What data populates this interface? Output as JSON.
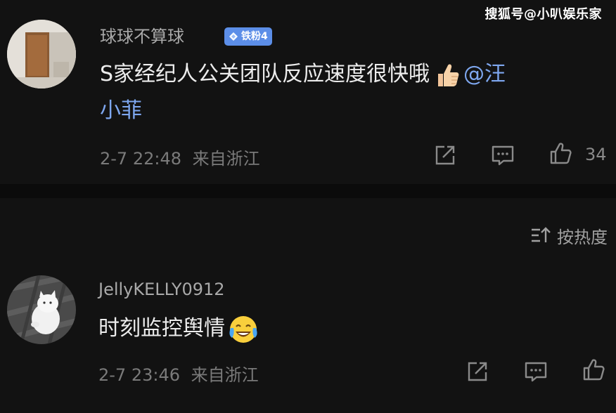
{
  "watermark": "搜狐号@小叭娱乐家",
  "comments": [
    {
      "username": "球球不算球",
      "badge": "铁粉4",
      "content_line1": "S家经纪人公关团队反应速度很快哦",
      "mention_part1": "@汪",
      "content_line2": "小菲",
      "timestamp": "2-7 22:48",
      "location": "来自浙江",
      "like_count": "34"
    },
    {
      "username": "JellyKELLY0912",
      "content": "时刻监控舆情",
      "timestamp": "2-7 23:46",
      "location": "来自浙江"
    }
  ],
  "sort": {
    "label": "按热度"
  },
  "icons": {
    "share": "share-icon",
    "comment": "comment-icon",
    "like": "thumbs-up-icon",
    "sort": "sort-icon",
    "thumbs_emoji": "thumbs-up-emoji-icon",
    "laugh_emoji": "laughing-crying-emoji-icon"
  },
  "colors": {
    "background": "#121212",
    "mention": "#7ea7ef",
    "badge": "#5c8ee8"
  }
}
